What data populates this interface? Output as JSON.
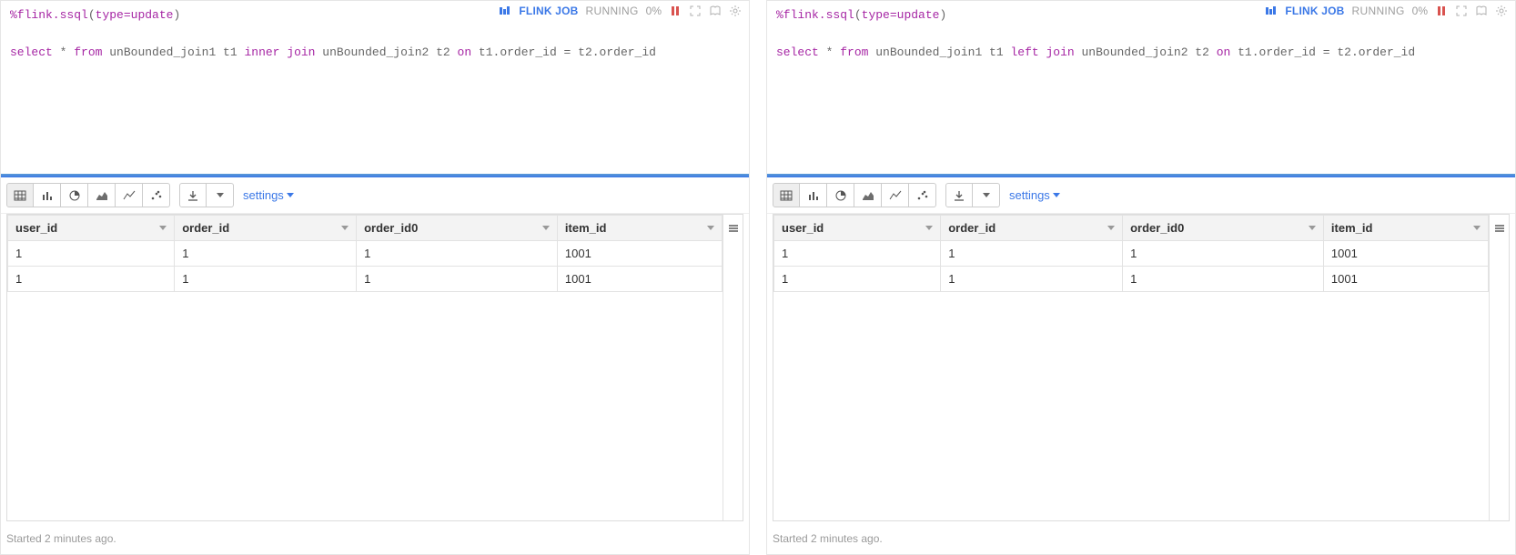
{
  "panes": [
    {
      "header": {
        "flink_job_label": "FLINK JOB",
        "status": "RUNNING",
        "progress": "0%"
      },
      "code": {
        "directive_prefix": "%flink.ssql",
        "directive_args": "type=update",
        "sql_tokens": [
          {
            "t": "key",
            "v": "select"
          },
          {
            "t": "text",
            "v": " * "
          },
          {
            "t": "key",
            "v": "from"
          },
          {
            "t": "text",
            "v": " unBounded_join1 t1 "
          },
          {
            "t": "key",
            "v": "inner join"
          },
          {
            "t": "text",
            "v": " unBounded_join2 t2 "
          },
          {
            "t": "key",
            "v": "on"
          },
          {
            "t": "text",
            "v": " t1.order_id = t2.order_id"
          }
        ]
      },
      "toolbar": {
        "settings_label": "settings"
      },
      "table": {
        "columns": [
          "user_id",
          "order_id",
          "order_id0",
          "item_id"
        ],
        "rows": [
          [
            "1",
            "1",
            "1",
            "1001"
          ],
          [
            "1",
            "1",
            "1",
            "1001"
          ]
        ]
      },
      "footer": "Started 2 minutes ago."
    },
    {
      "header": {
        "flink_job_label": "FLINK JOB",
        "status": "RUNNING",
        "progress": "0%"
      },
      "code": {
        "directive_prefix": "%flink.ssql",
        "directive_args": "type=update",
        "sql_tokens": [
          {
            "t": "key",
            "v": "select"
          },
          {
            "t": "text",
            "v": " * "
          },
          {
            "t": "key",
            "v": "from"
          },
          {
            "t": "text",
            "v": " unBounded_join1 t1 "
          },
          {
            "t": "key",
            "v": "left join"
          },
          {
            "t": "text",
            "v": " unBounded_join2 t2 "
          },
          {
            "t": "key",
            "v": "on"
          },
          {
            "t": "text",
            "v": " t1.order_id = t2.order_id"
          }
        ]
      },
      "toolbar": {
        "settings_label": "settings"
      },
      "table": {
        "columns": [
          "user_id",
          "order_id",
          "order_id0",
          "item_id"
        ],
        "rows": [
          [
            "1",
            "1",
            "1",
            "1001"
          ],
          [
            "1",
            "1",
            "1",
            "1001"
          ]
        ]
      },
      "footer": "Started 2 minutes ago."
    }
  ],
  "icons": {
    "table": "table-icon",
    "bar": "bar-chart-icon",
    "pie": "pie-chart-icon",
    "area": "area-chart-icon",
    "line": "line-chart-icon",
    "scatter": "scatter-chart-icon",
    "download": "download-icon",
    "pause": "pause-icon",
    "expand": "expand-icon",
    "book": "book-icon",
    "gear": "gear-icon",
    "hamburger": "hamburger-icon",
    "flink": "flink-bars-icon"
  }
}
